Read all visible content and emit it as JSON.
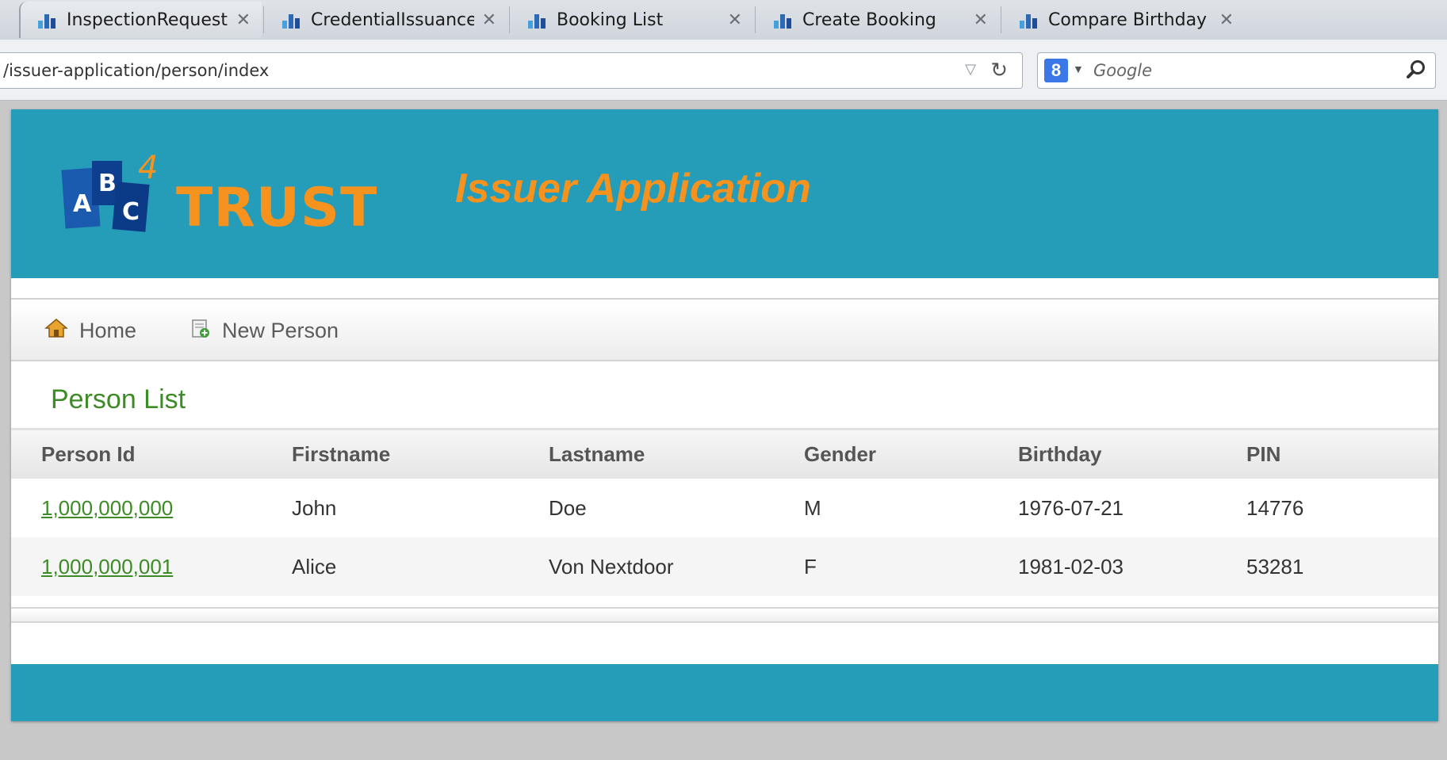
{
  "browser": {
    "tabs": [
      {
        "title": "InspectionRequest ...",
        "close": "✕"
      },
      {
        "title": "CredentialIssuance ...",
        "close": "✕"
      },
      {
        "title": "Booking List",
        "close": "✕"
      },
      {
        "title": "Create Booking",
        "close": "✕"
      },
      {
        "title": "Compare Birthday ...",
        "close": "✕"
      }
    ],
    "url": "/issuer-application/person/index",
    "search_engine_badge": "8",
    "search_placeholder": "Google"
  },
  "header": {
    "logo_letters": {
      "a": "A",
      "b": "B",
      "c": "C",
      "four": "4"
    },
    "logo_word": "TRUST",
    "app_title": "Issuer Application"
  },
  "menu": {
    "home_label": "Home",
    "new_person_label": "New Person"
  },
  "list": {
    "title": "Person List",
    "columns": [
      "Person Id",
      "Firstname",
      "Lastname",
      "Gender",
      "Birthday",
      "PIN"
    ],
    "rows": [
      {
        "id": "1,000,000,000",
        "firstname": "John",
        "lastname": "Doe",
        "gender": "M",
        "birthday": "1976-07-21",
        "pin": "14776"
      },
      {
        "id": "1,000,000,001",
        "firstname": "Alice",
        "lastname": "Von Nextdoor",
        "gender": "F",
        "birthday": "1981-02-03",
        "pin": "53281"
      }
    ]
  },
  "colors": {
    "header_teal": "#269db8",
    "accent_orange": "#f6921e",
    "link_green": "#3d8b26"
  },
  "icons": {
    "tab_favicon": "app-favicon-icon",
    "home": "house-icon",
    "new_person": "document-add-icon",
    "reload": "reload-icon",
    "search": "magnifier-icon"
  }
}
